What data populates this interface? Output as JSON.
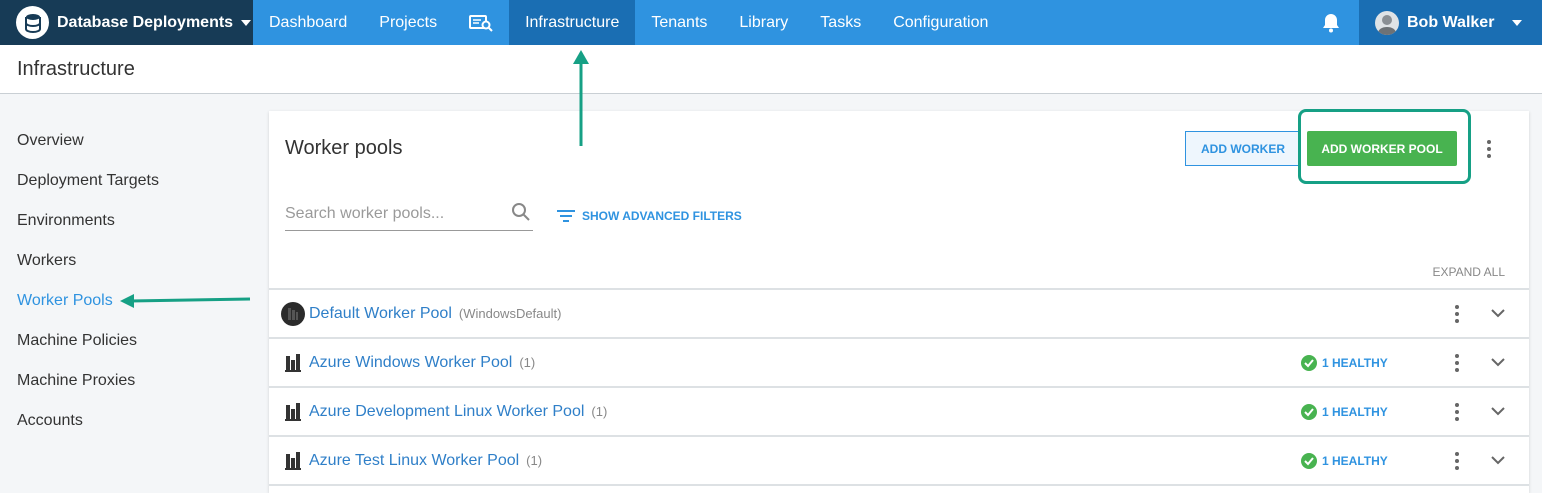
{
  "topbar": {
    "space_name": "Database Deployments",
    "nav_items": [
      {
        "label": "Dashboard"
      },
      {
        "label": "Projects"
      },
      {
        "label": "Infrastructure"
      },
      {
        "label": "Tenants"
      },
      {
        "label": "Library"
      },
      {
        "label": "Tasks"
      },
      {
        "label": "Configuration"
      }
    ],
    "user_name": "Bob Walker",
    "colors": {
      "nav": "#2f93e0",
      "space": "#173b56",
      "active": "#1a6eb3"
    }
  },
  "page": {
    "title": "Infrastructure"
  },
  "sidebar": {
    "items": [
      {
        "label": "Overview"
      },
      {
        "label": "Deployment Targets"
      },
      {
        "label": "Environments"
      },
      {
        "label": "Workers"
      },
      {
        "label": "Worker Pools"
      },
      {
        "label": "Machine Policies"
      },
      {
        "label": "Machine Proxies"
      },
      {
        "label": "Accounts"
      }
    ],
    "active": "Worker Pools"
  },
  "card": {
    "title": "Worker pools",
    "add_worker_label": "ADD WORKER",
    "add_pool_label": "ADD WORKER POOL",
    "search_placeholder": "Search worker pools...",
    "filters_label": "SHOW ADVANCED FILTERS",
    "expand_all_label": "EXPAND ALL"
  },
  "pools": [
    {
      "name": "Default Worker Pool",
      "meta": "(WindowsDefault)",
      "health": ""
    },
    {
      "name": "Azure Windows Worker Pool",
      "meta": "(1)",
      "health": "1 HEALTHY"
    },
    {
      "name": "Azure Development Linux Worker Pool",
      "meta": "(1)",
      "health": "1 HEALTHY"
    },
    {
      "name": "Azure Test Linux Worker Pool",
      "meta": "(1)",
      "health": "1 HEALTHY"
    }
  ],
  "annotation_color": "#16a085"
}
